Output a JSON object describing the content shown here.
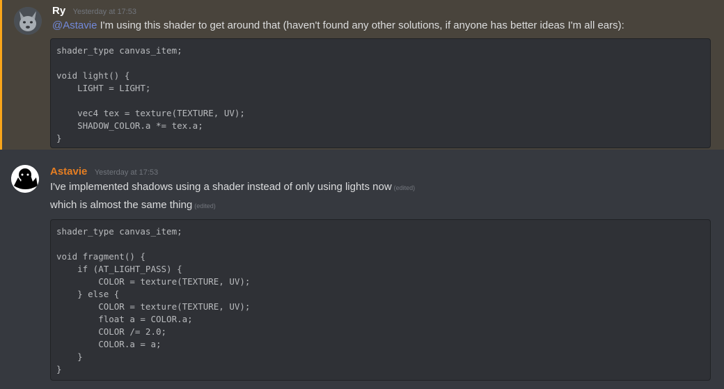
{
  "messages": [
    {
      "author": "Ry",
      "author_color": "#ffffff",
      "timestamp": "Yesterday at 17:53",
      "mention": "@Astavie",
      "text": " I'm using this shader to get around that (haven't found any other solutions, if anyone has better ideas I'm all ears):",
      "code": [
        "shader_type canvas_item;",
        "",
        "void light() {",
        "    LIGHT = LIGHT;",
        "",
        "    vec4 tex = texture(TEXTURE, UV);",
        "    SHADOW_COLOR.a *= tex.a;",
        "}"
      ]
    },
    {
      "author": "Astavie",
      "author_color": "#e67e22",
      "timestamp": "Yesterday at 17:53",
      "lines": [
        {
          "text": "I've implemented shadows using a shader instead of only using lights now",
          "edited": "(edited)"
        },
        {
          "text": "which is almost the same thing",
          "edited": "(edited)"
        }
      ],
      "code": [
        "shader_type canvas_item;",
        "",
        "void fragment() {",
        "    if (AT_LIGHT_PASS) {",
        "        COLOR = texture(TEXTURE, UV);",
        "    } else {",
        "        COLOR = texture(TEXTURE, UV);",
        "        float a = COLOR.a;",
        "        COLOR /= 2.0;",
        "        COLOR.a = a;",
        "    }",
        "}"
      ]
    }
  ]
}
